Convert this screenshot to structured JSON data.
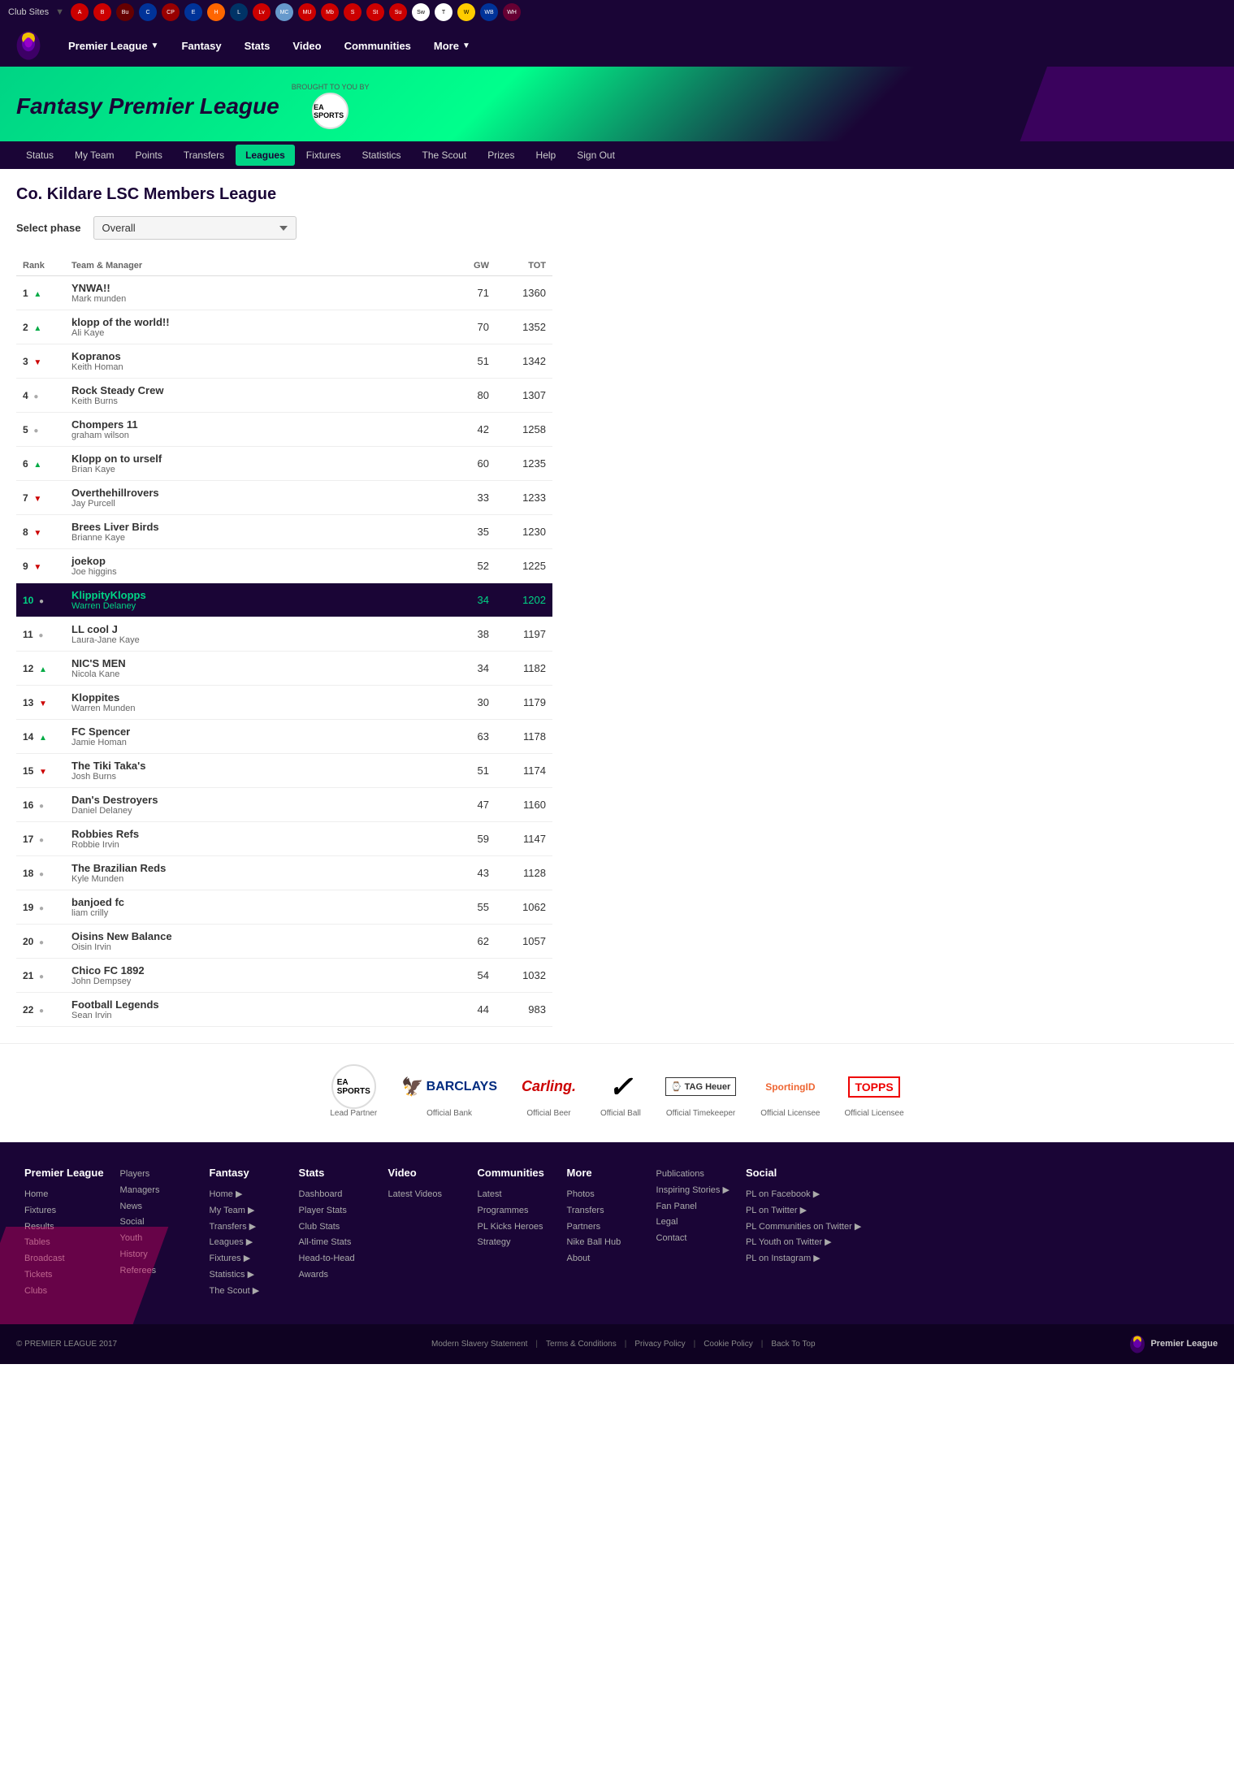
{
  "clubBar": {
    "label": "Club Sites",
    "clubs": [
      "Arsenal",
      "Bournemouth",
      "Burnley",
      "Chelsea",
      "Crystal Palace",
      "Everton",
      "Hull",
      "Leicester",
      "Liverpool",
      "Man City",
      "Man Utd",
      "Middlesbrough",
      "Southampton",
      "Stoke",
      "Sunderland",
      "Swansea",
      "Tottenham",
      "Watford",
      "West Brom",
      "West Ham"
    ]
  },
  "mainNav": {
    "title": "Premier League",
    "links": [
      {
        "label": "Premier League",
        "hasArrow": true
      },
      {
        "label": "Fantasy"
      },
      {
        "label": "Stats"
      },
      {
        "label": "Video"
      },
      {
        "label": "Communities"
      },
      {
        "label": "More",
        "hasArrow": true
      }
    ]
  },
  "fplHeader": {
    "title": "Fantasy Premier League",
    "broughtText": "BROUGHT TO YOU BY",
    "eaLabel": "EA SPORTS"
  },
  "subNav": {
    "tabs": [
      {
        "label": "Status"
      },
      {
        "label": "My Team"
      },
      {
        "label": "Points"
      },
      {
        "label": "Transfers"
      },
      {
        "label": "Leagues",
        "active": true
      },
      {
        "label": "Fixtures"
      },
      {
        "label": "Statistics"
      },
      {
        "label": "The Scout"
      },
      {
        "label": "Prizes"
      },
      {
        "label": "Help"
      },
      {
        "label": "Sign Out"
      }
    ]
  },
  "leagueTitle": "Co. Kildare LSC Members League",
  "phaseLabel": "Select phase",
  "phaseOption": "Overall",
  "tableHeaders": {
    "rank": "Rank",
    "teamManager": "Team & Manager",
    "gw": "GW",
    "tot": "TOT"
  },
  "standings": [
    {
      "rank": 1,
      "trend": "up",
      "teamName": "YNWA!!",
      "manager": "Mark munden",
      "gw": 71,
      "tot": 1360,
      "highlighted": false
    },
    {
      "rank": 2,
      "trend": "up",
      "teamName": "klopp of the world!!",
      "manager": "Ali Kaye",
      "gw": 70,
      "tot": 1352,
      "highlighted": false
    },
    {
      "rank": 3,
      "trend": "down",
      "teamName": "Kopranos",
      "manager": "Keith Homan",
      "gw": 51,
      "tot": 1342,
      "highlighted": false
    },
    {
      "rank": 4,
      "trend": "neutral",
      "teamName": "Rock Steady Crew",
      "manager": "Keith Burns",
      "gw": 80,
      "tot": 1307,
      "highlighted": false
    },
    {
      "rank": 5,
      "trend": "neutral",
      "teamName": "Chompers 11",
      "manager": "graham wilson",
      "gw": 42,
      "tot": 1258,
      "highlighted": false
    },
    {
      "rank": 6,
      "trend": "up",
      "teamName": "Klopp on to urself",
      "manager": "Brian Kaye",
      "gw": 60,
      "tot": 1235,
      "highlighted": false
    },
    {
      "rank": 7,
      "trend": "down",
      "teamName": "Overthehillrovers",
      "manager": "Jay Purcell",
      "gw": 33,
      "tot": 1233,
      "highlighted": false
    },
    {
      "rank": 8,
      "trend": "down",
      "teamName": "Brees Liver Birds",
      "manager": "Brianne Kaye",
      "gw": 35,
      "tot": 1230,
      "highlighted": false
    },
    {
      "rank": 9,
      "trend": "down",
      "teamName": "joekop",
      "manager": "Joe higgins",
      "gw": 52,
      "tot": 1225,
      "highlighted": false
    },
    {
      "rank": 10,
      "trend": "neutral",
      "teamName": "KlippityKlopps",
      "manager": "Warren Delaney",
      "gw": 34,
      "tot": 1202,
      "highlighted": true
    },
    {
      "rank": 11,
      "trend": "neutral",
      "teamName": "LL cool J",
      "manager": "Laura-Jane Kaye",
      "gw": 38,
      "tot": 1197,
      "highlighted": false
    },
    {
      "rank": 12,
      "trend": "up",
      "teamName": "NIC'S MEN",
      "manager": "Nicola Kane",
      "gw": 34,
      "tot": 1182,
      "highlighted": false
    },
    {
      "rank": 13,
      "trend": "down",
      "teamName": "Kloppites",
      "manager": "Warren Munden",
      "gw": 30,
      "tot": 1179,
      "highlighted": false
    },
    {
      "rank": 14,
      "trend": "up",
      "teamName": "FC Spencer",
      "manager": "Jamie Homan",
      "gw": 63,
      "tot": 1178,
      "highlighted": false
    },
    {
      "rank": 15,
      "trend": "down",
      "teamName": "The Tiki Taka's",
      "manager": "Josh Burns",
      "gw": 51,
      "tot": 1174,
      "highlighted": false
    },
    {
      "rank": 16,
      "trend": "neutral",
      "teamName": "Dan's Destroyers",
      "manager": "Daniel Delaney",
      "gw": 47,
      "tot": 1160,
      "highlighted": false
    },
    {
      "rank": 17,
      "trend": "neutral",
      "teamName": "Robbies Refs",
      "manager": "Robbie Irvin",
      "gw": 59,
      "tot": 1147,
      "highlighted": false
    },
    {
      "rank": 18,
      "trend": "neutral",
      "teamName": "The Brazilian Reds",
      "manager": "Kyle Munden",
      "gw": 43,
      "tot": 1128,
      "highlighted": false
    },
    {
      "rank": 19,
      "trend": "neutral",
      "teamName": "banjoed fc",
      "manager": "liam crilly",
      "gw": 55,
      "tot": 1062,
      "highlighted": false
    },
    {
      "rank": 20,
      "trend": "neutral",
      "teamName": "Oisins New Balance",
      "manager": "Oisin Irvin",
      "gw": 62,
      "tot": 1057,
      "highlighted": false
    },
    {
      "rank": 21,
      "trend": "neutral",
      "teamName": "Chico FC 1892",
      "manager": "John Dempsey",
      "gw": 54,
      "tot": 1032,
      "highlighted": false
    },
    {
      "rank": 22,
      "trend": "neutral",
      "teamName": "Football Legends",
      "manager": "Sean Irvin",
      "gw": 44,
      "tot": 983,
      "highlighted": false
    }
  ],
  "sponsors": [
    {
      "label": "Lead Partner",
      "name": "EA Sports"
    },
    {
      "label": "Official Bank",
      "name": "Barclays"
    },
    {
      "label": "Official Beer",
      "name": "Carling"
    },
    {
      "label": "Official Ball",
      "name": "Nike"
    },
    {
      "label": "Official Timekeeper",
      "name": "TAG Heuer"
    },
    {
      "label": "Official Licensee",
      "name": "SportingID"
    },
    {
      "label": "Official Licensee",
      "name": "Topps"
    }
  ],
  "footer": {
    "columns": [
      {
        "title": "Premier League",
        "links": [
          {
            "label": "Home"
          },
          {
            "label": "Fixtures"
          },
          {
            "label": "Results"
          },
          {
            "label": "Tables"
          },
          {
            "label": "Broadcast"
          },
          {
            "label": "Tickets"
          },
          {
            "label": "Clubs"
          }
        ]
      },
      {
        "title": "",
        "links": [
          {
            "label": "Players"
          },
          {
            "label": "Managers"
          },
          {
            "label": "News"
          },
          {
            "label": "Social"
          },
          {
            "label": "Youth"
          },
          {
            "label": "History"
          },
          {
            "label": "Referees"
          }
        ]
      },
      {
        "title": "Fantasy",
        "links": [
          {
            "label": "Home ▶"
          },
          {
            "label": "My Team ▶"
          },
          {
            "label": "Transfers ▶"
          },
          {
            "label": "Leagues ▶"
          },
          {
            "label": "Fixtures ▶"
          },
          {
            "label": "Statistics ▶"
          },
          {
            "label": "The Scout ▶"
          }
        ]
      },
      {
        "title": "Stats",
        "links": [
          {
            "label": "Dashboard"
          },
          {
            "label": "Player Stats"
          },
          {
            "label": "Club Stats"
          },
          {
            "label": "All-time Stats"
          },
          {
            "label": "Head-to-Head"
          },
          {
            "label": "Awards"
          }
        ]
      },
      {
        "title": "Video",
        "links": [
          {
            "label": "Latest Videos"
          }
        ]
      },
      {
        "title": "Communities",
        "links": [
          {
            "label": "Latest"
          },
          {
            "label": "Programmes"
          },
          {
            "label": "PL Kicks Heroes"
          },
          {
            "label": "Strategy"
          }
        ]
      },
      {
        "title": "More",
        "links": [
          {
            "label": "Photos"
          },
          {
            "label": "Transfers"
          },
          {
            "label": "Partners"
          },
          {
            "label": "Nike Ball Hub"
          },
          {
            "label": "About"
          }
        ]
      },
      {
        "title": "",
        "links": [
          {
            "label": "Publications"
          },
          {
            "label": "Inspiring Stories ▶"
          },
          {
            "label": "Fan Panel"
          },
          {
            "label": "Legal"
          },
          {
            "label": "Contact"
          }
        ]
      },
      {
        "title": "Social",
        "links": [
          {
            "label": "PL on Facebook ▶"
          },
          {
            "label": "PL on Twitter ▶"
          },
          {
            "label": "PL Communities on Twitter ▶"
          },
          {
            "label": "PL Youth on Twitter ▶"
          },
          {
            "label": "PL on Instagram ▶"
          }
        ]
      }
    ],
    "bottomLinks": [
      {
        "label": "Modern Slavery Statement"
      },
      {
        "label": "Terms & Conditions"
      },
      {
        "label": "Privacy Policy"
      },
      {
        "label": "Cookie Policy"
      },
      {
        "label": "Back To Top"
      }
    ],
    "copyright": "© PREMIER LEAGUE 2017"
  }
}
